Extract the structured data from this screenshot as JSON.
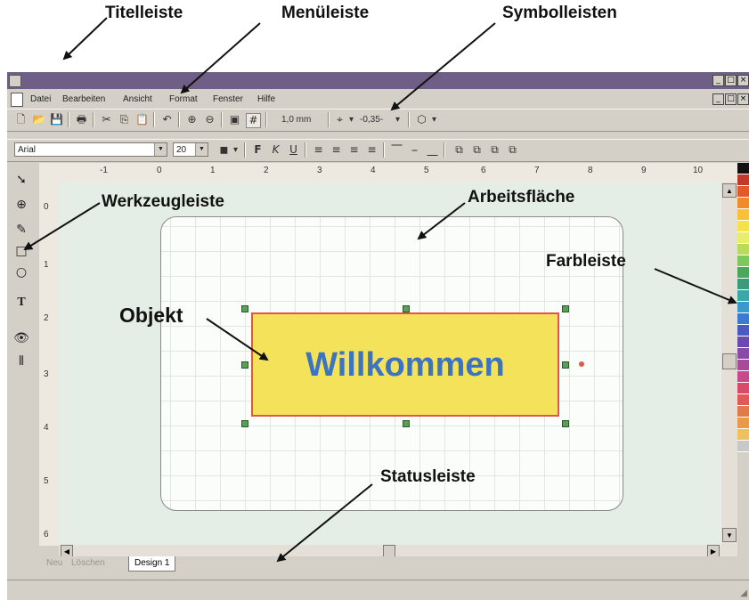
{
  "callouts": {
    "titlebar": "Titelleiste",
    "menubar": "Menüleiste",
    "toolbars": "Symbolleisten",
    "toolbox": "Werkzeugleiste",
    "workspace": "Arbeitsfläche",
    "colorbar": "Farbleiste",
    "object": "Objekt",
    "statusbar": "Statusleiste"
  },
  "window": {
    "buttons": [
      "_",
      "□",
      "×"
    ],
    "doc_buttons": [
      "_",
      "□",
      "×"
    ]
  },
  "menu": [
    "Datei",
    "Bearbeiten",
    "Ansicht",
    "Format",
    "Fenster",
    "Hilfe"
  ],
  "toolbar1": {
    "line_width": "1,0 mm",
    "offset": "-0,35-"
  },
  "toolbar2": {
    "font": "Arial",
    "size": "20",
    "bold": "F",
    "italic": "K",
    "underline": "U"
  },
  "ruler": {
    "h": [
      "-1",
      "0",
      "1",
      "2",
      "3",
      "4",
      "5",
      "6",
      "7",
      "8",
      "9",
      "10"
    ],
    "v": [
      "0",
      "1",
      "2",
      "3",
      "4",
      "5",
      "6"
    ]
  },
  "canvas": {
    "object_text": "Willkommen",
    "colors": {
      "object_fill": "#f3e25a",
      "object_border": "#e0564a",
      "text": "#3d74c2",
      "canvas_bg": "#e4eee6"
    }
  },
  "tabs": [
    "Neu",
    "Löschen",
    "Design 1"
  ],
  "palette": [
    "#111111",
    "#c0392b",
    "#e25a2a",
    "#f08a2a",
    "#f5c23a",
    "#f5e24a",
    "#e8ee6a",
    "#b8dc5a",
    "#7cc85a",
    "#4aa85a",
    "#3a9a7a",
    "#3aa8a8",
    "#3a9ad0",
    "#3a7ad0",
    "#4a5ac0",
    "#6a4ab0",
    "#8a4aa8",
    "#a84a9a",
    "#c84a8a",
    "#d84a6a",
    "#e05a5a",
    "#e07a4a",
    "#e89a4a",
    "#f0c060",
    "#c8c8c8"
  ]
}
